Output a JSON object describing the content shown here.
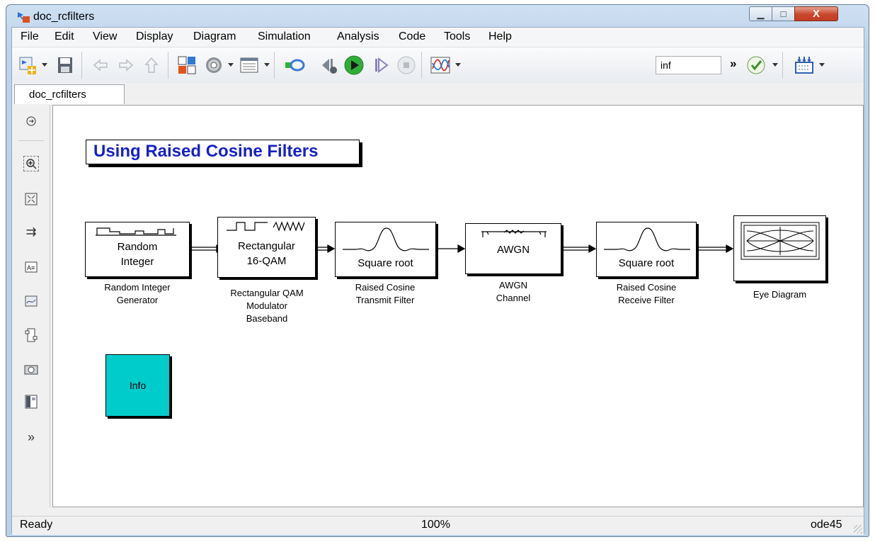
{
  "window": {
    "title": "doc_rcfilters",
    "minimize_glyph": "▁",
    "maximize_glyph": "□",
    "close_glyph": "X"
  },
  "menu": [
    "File",
    "Edit",
    "View",
    "Display",
    "Diagram",
    "Simulation",
    "Analysis",
    "Code",
    "Tools",
    "Help"
  ],
  "toolbar": {
    "icons": [
      "new-model-icon",
      "save-icon",
      "back-icon",
      "forward-icon",
      "up-icon",
      "library-browser-icon",
      "model-config-icon",
      "model-explorer-icon",
      "step-back-icon",
      "run-icon",
      "step-forward-icon",
      "stop-icon",
      "scope-icon",
      "model-advisor-icon",
      "build-icon"
    ],
    "stop_time": "inf",
    "overflow": "»"
  },
  "tabs": [
    "doc_rcfilters"
  ],
  "palette": [
    "navigate-icon",
    "zoom-icon",
    "fit-view-icon",
    "arrow-icon",
    "annotation-icon",
    "image-icon",
    "subsystem-icon",
    "snapshot-icon",
    "model-browser-icon",
    "more-icon"
  ],
  "palette_more": "»",
  "diagram": {
    "title": "Using Raised Cosine Filters",
    "blocks": [
      {
        "id": "random-integer-generator",
        "inner": [
          "Random",
          "Integer"
        ],
        "label": [
          "Random Integer",
          "Generator"
        ]
      },
      {
        "id": "rectangular-qam-modulator",
        "inner": [
          "Rectangular",
          "16-QAM"
        ],
        "label": [
          "Rectangular QAM",
          "Modulator",
          "Baseband"
        ]
      },
      {
        "id": "raised-cosine-transmit-filter",
        "inner": [
          "Square root"
        ],
        "label": [
          "Raised Cosine",
          "Transmit Filter"
        ]
      },
      {
        "id": "awgn-channel",
        "inner": [
          "AWGN"
        ],
        "label": [
          "AWGN",
          "Channel"
        ]
      },
      {
        "id": "raised-cosine-receive-filter",
        "inner": [
          "Square root"
        ],
        "label": [
          "Raised Cosine",
          "Receive Filter"
        ]
      },
      {
        "id": "eye-diagram",
        "inner": [],
        "label": [
          "Eye Diagram"
        ]
      }
    ],
    "info_block": "Info"
  },
  "status": {
    "state": "Ready",
    "zoom": "100%",
    "solver": "ode45"
  }
}
